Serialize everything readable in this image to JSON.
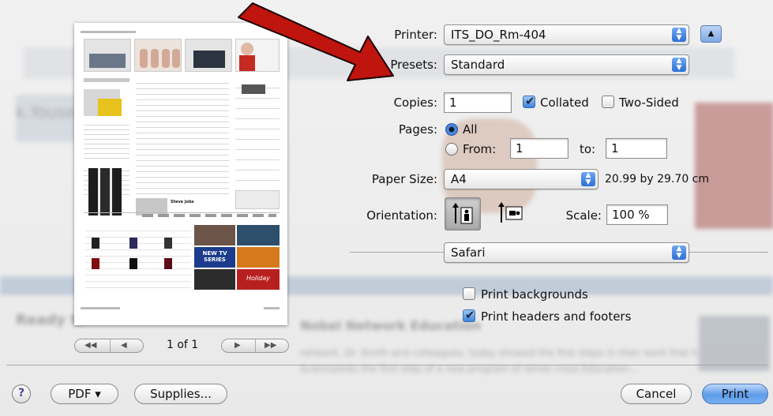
{
  "background_ghost_text": {
    "left_heading": "k.Youse",
    "bottom_heading": "Ready to",
    "bottom_article": "Nobel Network Education",
    "bottom_excerpt": "network. Dr. Smith and colleagues, today showed the first steps in their work that has",
    "bottom_excerpt2": "Science/edu the first step of a new program of sense cross Education..."
  },
  "preview": {
    "page_indicator": "1 of 1",
    "first_page_symbol": "◀◀",
    "prev_page_symbol": "◀",
    "next_page_symbol": "▶",
    "last_page_symbol": "▶▶",
    "thumb_promo_title": "Steve Jobs",
    "thumb_tile_caption": "NEW TV SERIES",
    "thumb_tile_caption2": "Holiday"
  },
  "printer": {
    "label": "Printer:",
    "value": "ITS_DO_Rm-404"
  },
  "presets": {
    "label": "Presets:",
    "value": "Standard"
  },
  "copies": {
    "label": "Copies:",
    "value": "1",
    "collated_label": "Collated",
    "collated_checked": true,
    "two_sided_label": "Two-Sided",
    "two_sided_checked": false
  },
  "pages": {
    "label": "Pages:",
    "all_label": "All",
    "from_label": "From:",
    "from_value": "1",
    "to_label": "to:",
    "to_value": "1",
    "selected": "All"
  },
  "paper_size": {
    "label": "Paper Size:",
    "value": "A4",
    "dimensions": "20.99 by 29.70 cm"
  },
  "orientation": {
    "label": "Orientation:",
    "selected": "portrait"
  },
  "scale": {
    "label": "Scale:",
    "value": "100 %"
  },
  "app_section": {
    "value": "Safari"
  },
  "safari_options": {
    "print_backgrounds_label": "Print backgrounds",
    "print_backgrounds_checked": false,
    "print_headers_label": "Print headers and footers",
    "print_headers_checked": true
  },
  "footer": {
    "help_symbol": "?",
    "pdf_label": "PDF ▾",
    "supplies_label": "Supplies...",
    "cancel_label": "Cancel",
    "print_label": "Print"
  },
  "colors": {
    "arrow": "#c0140e",
    "default_button": "#5d9ce9",
    "popup_arrow": "#2d6fd6"
  }
}
